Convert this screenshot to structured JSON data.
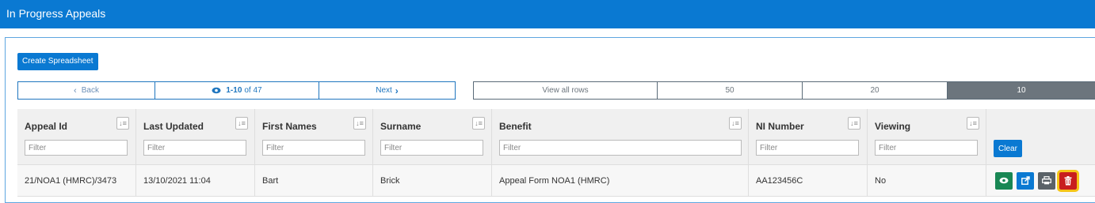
{
  "header": {
    "title": "In Progress Appeals"
  },
  "toolbar": {
    "create_label": "Create Spreadsheet"
  },
  "pager": {
    "back_label": "Back",
    "range": "1-10",
    "of_text": "of 47",
    "next_label": "Next"
  },
  "rows_selector": {
    "options": [
      "View all rows",
      "50",
      "20",
      "10"
    ],
    "selected": "10"
  },
  "table": {
    "columns": [
      "Appeal Id",
      "Last Updated",
      "First Names",
      "Surname",
      "Benefit",
      "NI Number",
      "Viewing"
    ],
    "filter_placeholder": "Filter",
    "clear_label": "Clear",
    "rows": [
      [
        "21/NOA1 (HMRC)/3473",
        "13/10/2021 11:04",
        "Bart",
        "Brick",
        "Appeal Form NOA1 (HMRC)",
        "AA123456C",
        "No"
      ]
    ]
  },
  "icons": [
    "eye-icon",
    "share-icon",
    "print-icon",
    "trash-icon",
    "chevron-left-icon",
    "chevron-right-icon",
    "sort-icon"
  ],
  "colors": {
    "brand": "#0a79d2",
    "view": "#198754",
    "print": "#5a6268",
    "delete": "#c81e1e",
    "highlight": "#f5c518"
  }
}
